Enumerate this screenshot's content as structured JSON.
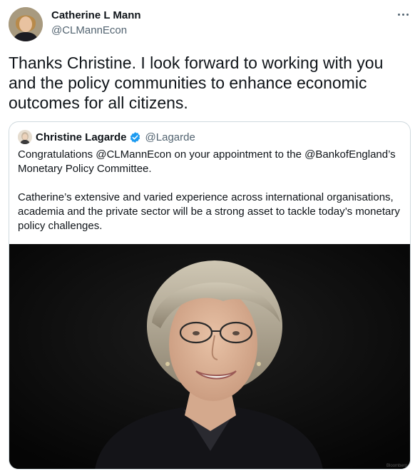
{
  "author": {
    "name": "Catherine L Mann",
    "handle": "@CLMannEcon",
    "avatar_icon": "person-avatar"
  },
  "more_icon": "more-horizontal-icon",
  "tweet_text": "Thanks Christine.  I look forward to working with you and the policy communities to enhance economic outcomes for all citizens.",
  "quoted_tweet": {
    "name": "Christine Lagarde",
    "handle": "@Lagarde",
    "verified": true,
    "paragraph_1": "Congratulations @CLMannEcon on your appointment to the @BankofEngland’s Monetary Policy Committee.",
    "paragraph_2": "Catherine’s extensive and varied experience across international organisations, academia and the private sector will be a strong asset to tackle today’s monetary policy challenges.",
    "media": {
      "watermark": "Bloomberg"
    }
  },
  "colors": {
    "text_primary": "#0f1419",
    "text_secondary": "#536471",
    "verified_blue": "#1d9bf0",
    "border": "#cfd9de"
  }
}
